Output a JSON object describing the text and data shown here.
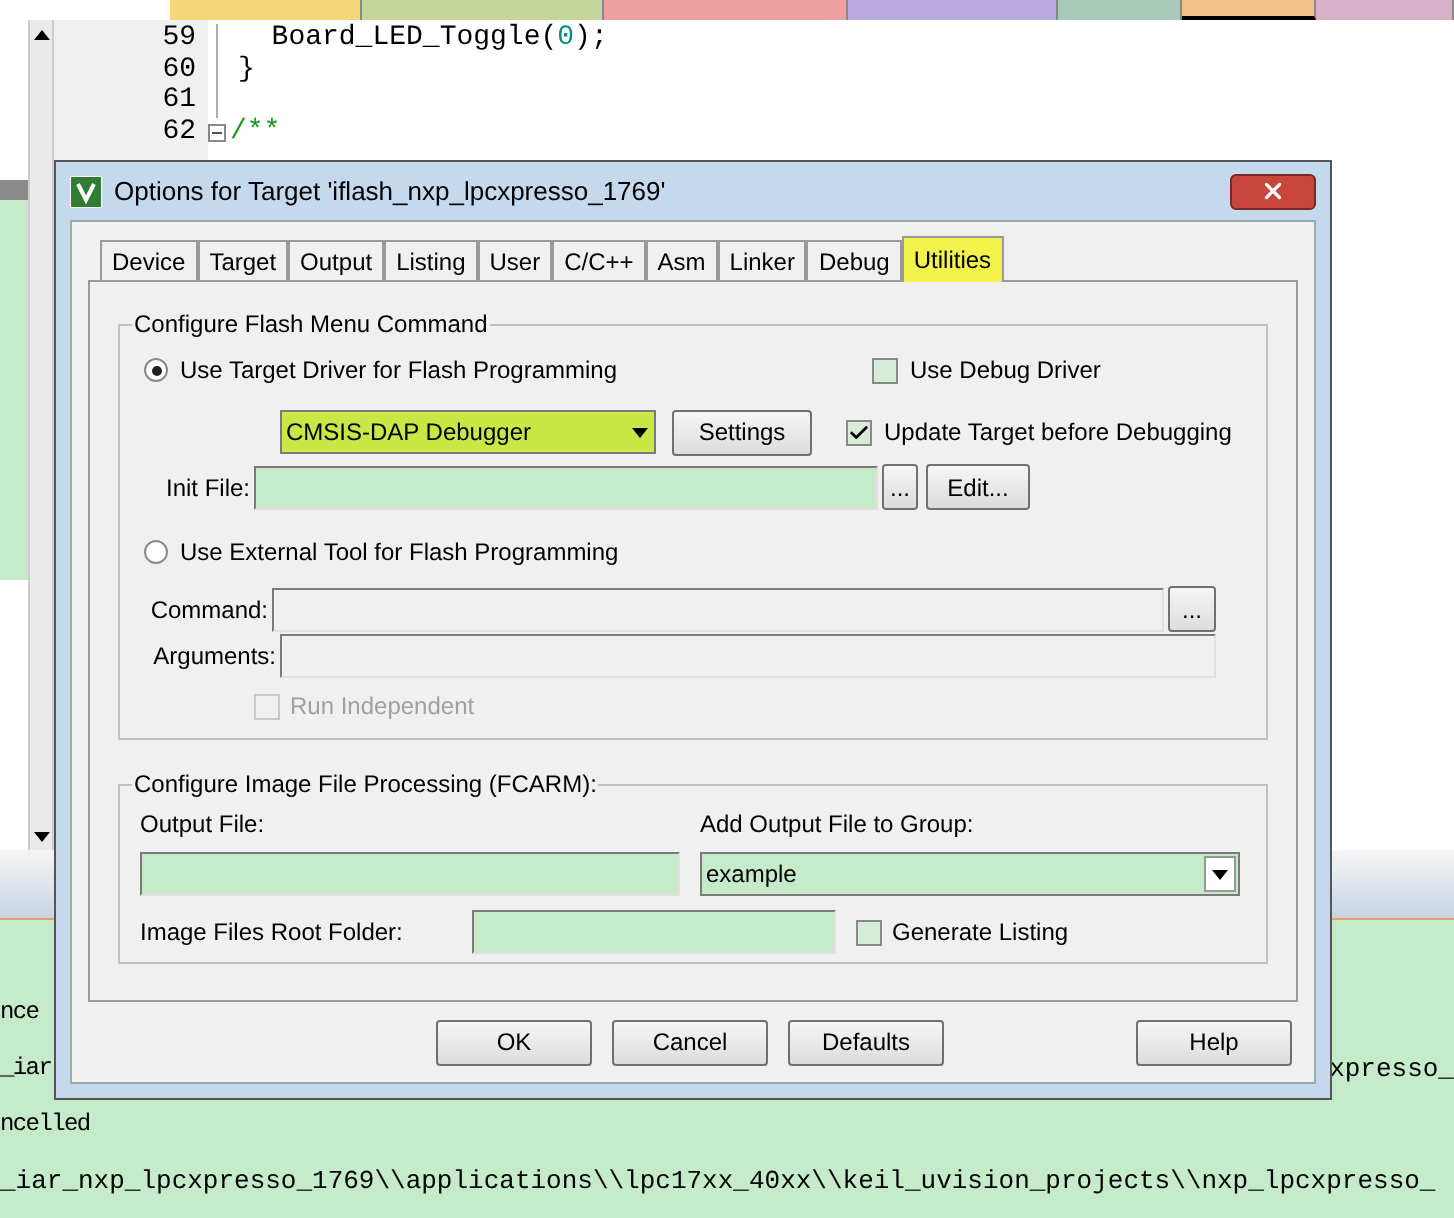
{
  "editor": {
    "file_tabs": [
      {
        "color": "#f5d77a",
        "selected": false
      },
      {
        "color": "#c5d69c",
        "selected": false
      },
      {
        "color": "#f0a0a0",
        "selected": false
      },
      {
        "color": "#b8a9de",
        "selected": false
      },
      {
        "color": "#a8c8b8",
        "selected": false
      },
      {
        "color": "#f3c08a",
        "selected": true
      },
      {
        "color": "#d8b0c8",
        "selected": false
      }
    ],
    "lines": [
      {
        "number": "59",
        "segments": [
          {
            "kind": "plain",
            "text": "  Board_LED_Toggle("
          },
          {
            "kind": "number",
            "text": "0"
          },
          {
            "kind": "plain",
            "text": ");"
          }
        ]
      },
      {
        "number": "60",
        "segments": [
          {
            "kind": "plain",
            "text": "}"
          }
        ]
      },
      {
        "number": "61"
      },
      {
        "number": "62",
        "fold": true,
        "segments": [
          {
            "kind": "comment",
            "text": "/**"
          }
        ]
      }
    ]
  },
  "output": [
    {
      "left": "nce"
    },
    {
      "left": "_iar",
      "right": "xpresso_"
    },
    {
      "left": "ncelled"
    },
    {
      "left": "_iar_nxp_lpcxpresso_1769\\\\applications\\\\lpc17xx_40xx\\\\keil_uvision_projects\\\\nxp_lpcxpresso_"
    }
  ],
  "dialog": {
    "title": "Options for Target 'iflash_nxp_lpcxpresso_1769'",
    "tabs": [
      {
        "label": "Device",
        "selected": false,
        "highlight": false
      },
      {
        "label": "Target",
        "selected": false,
        "highlight": false
      },
      {
        "label": "Output",
        "selected": false,
        "highlight": false
      },
      {
        "label": "Listing",
        "selected": false,
        "highlight": false
      },
      {
        "label": "User",
        "selected": false,
        "highlight": false
      },
      {
        "label": "C/C++",
        "selected": false,
        "highlight": false
      },
      {
        "label": "Asm",
        "selected": false,
        "highlight": false
      },
      {
        "label": "Linker",
        "selected": false,
        "highlight": false
      },
      {
        "label": "Debug",
        "selected": false,
        "highlight": false
      },
      {
        "label": "Utilities",
        "selected": true,
        "highlight": true
      }
    ],
    "flash_group": {
      "title": "Configure Flash Menu Command",
      "target_driver": {
        "label": "Use Target Driver for Flash Programming",
        "selected": true
      },
      "driver_select": {
        "value": "CMSIS-DAP Debugger",
        "highlight": true
      },
      "settings_button": "Settings",
      "use_debug_driver": {
        "label": "Use Debug Driver",
        "checked": false
      },
      "update_target": {
        "label": "Update Target before Debugging",
        "checked": true
      },
      "init_file": {
        "label": "Init File:",
        "browse": "...",
        "edit": "Edit..."
      },
      "external_tool": {
        "label": "Use External Tool for Flash Programming",
        "selected": false
      },
      "command": {
        "label": "Command:",
        "browse": "..."
      },
      "arguments": {
        "label": "Arguments:"
      },
      "run_independent": {
        "label": "Run Independent",
        "checked": false,
        "disabled": true
      }
    },
    "image_group": {
      "title": "Configure Image File Processing (FCARM):",
      "output_file": {
        "label": "Output File:"
      },
      "add_to_group": {
        "label": "Add Output File  to Group:",
        "value": "example"
      },
      "root_folder": {
        "label": "Image Files Root Folder:"
      },
      "generate_listing": {
        "label": "Generate Listing",
        "checked": false
      }
    },
    "buttons": [
      "OK",
      "Cancel",
      "Defaults",
      "Help"
    ]
  }
}
